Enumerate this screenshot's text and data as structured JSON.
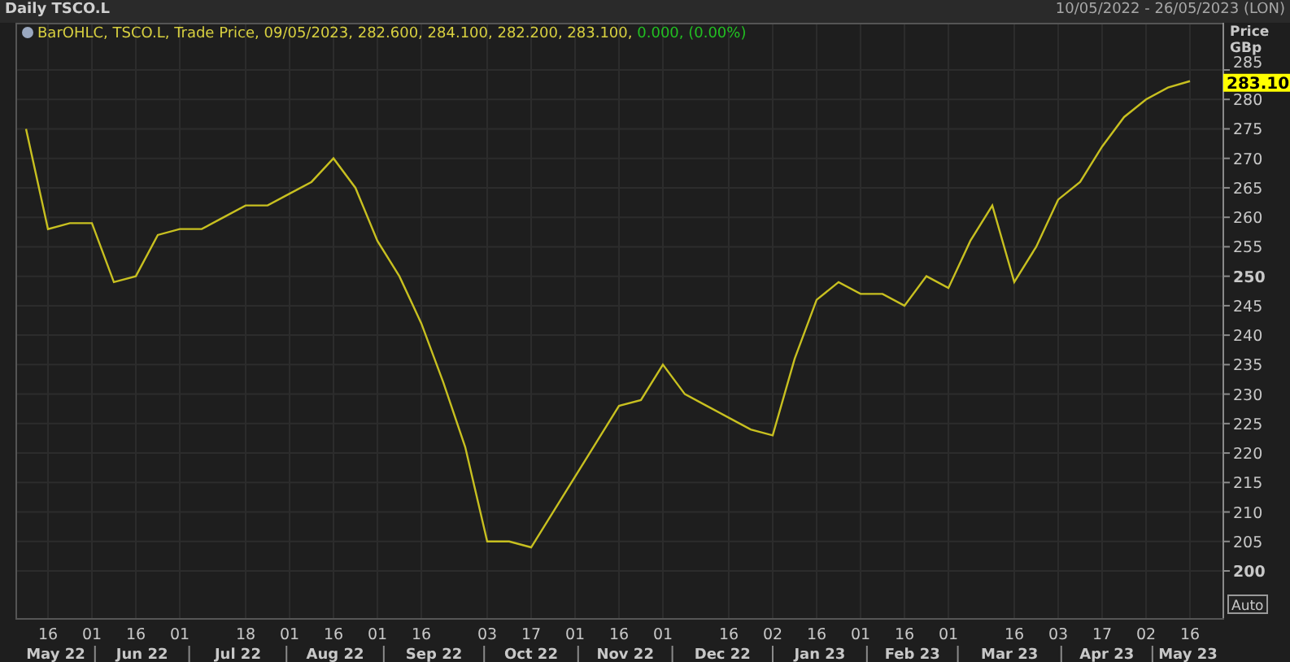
{
  "header": {
    "title": "Daily TSCO.L",
    "range": "10/05/2022 - 26/05/2023 (LON)"
  },
  "legend": {
    "text": "BarOHLC, TSCO.L, Trade Price, 09/05/2023, 282.600, 284.100, 282.200, 283.100,",
    "change": "0.000, (0.00%)"
  },
  "axis": {
    "title": "Price",
    "unit": "GBp",
    "last_price": "283.10",
    "auto_button": "Auto",
    "month_labels": [
      "May 22",
      "Jun 22",
      "Jul 22",
      "Aug 22",
      "Sep 22",
      "Oct 22",
      "Nov 22",
      "Dec 22",
      "Jan 23",
      "Feb 23",
      "Mar 23",
      "Apr 23",
      "May 23"
    ]
  },
  "chart_data": {
    "type": "line",
    "grid": true,
    "ylim": [
      192,
      293
    ],
    "categories": [
      null,
      "16",
      null,
      "01",
      null,
      "16",
      null,
      "01",
      null,
      null,
      "18",
      null,
      "01",
      null,
      "16",
      null,
      "01",
      null,
      "16",
      null,
      null,
      "03",
      null,
      "17",
      null,
      "01",
      null,
      "16",
      null,
      "01",
      null,
      null,
      "16",
      null,
      "02",
      null,
      "16",
      null,
      "01",
      null,
      "16",
      null,
      "01",
      null,
      null,
      "16",
      null,
      "03",
      null,
      "17",
      null,
      "02",
      null,
      "16"
    ],
    "yticks": [
      200,
      205,
      210,
      215,
      220,
      225,
      230,
      235,
      240,
      245,
      250,
      255,
      260,
      265,
      270,
      275,
      280,
      285
    ],
    "series": [
      {
        "color": "#c8c020",
        "values": [
          275,
          258,
          259,
          259,
          249,
          250,
          257,
          258,
          258,
          260,
          262,
          262,
          264,
          266,
          270,
          265,
          256,
          250,
          242,
          232,
          221,
          205,
          205,
          204,
          210,
          216,
          222,
          228,
          229,
          235,
          230,
          228,
          226,
          224,
          223,
          236,
          246,
          249,
          247,
          247,
          245,
          250,
          248,
          256,
          262,
          249,
          255,
          263,
          266,
          272,
          277,
          280,
          282,
          283.1
        ]
      }
    ]
  }
}
